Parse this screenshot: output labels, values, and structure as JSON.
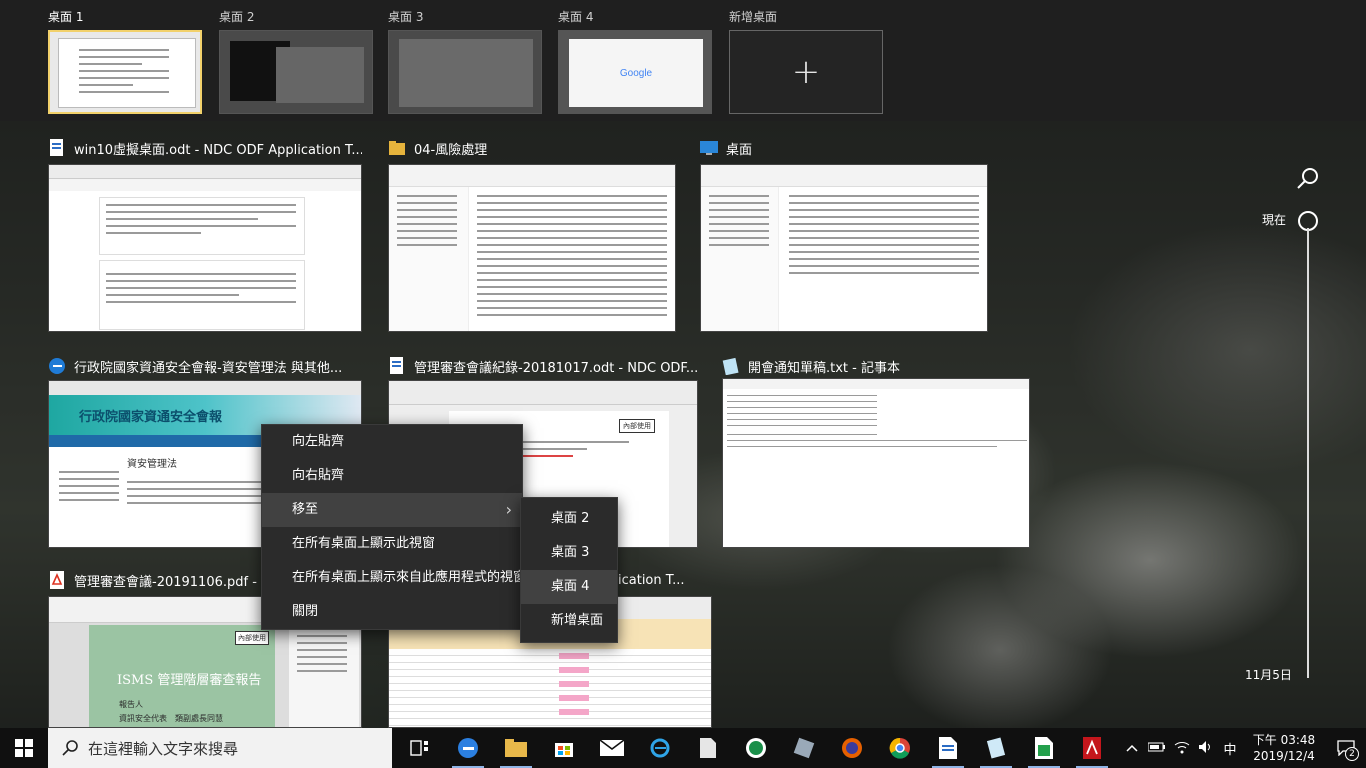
{
  "desktops": [
    {
      "label": "桌面 1",
      "active": true
    },
    {
      "label": "桌面 2",
      "active": false
    },
    {
      "label": "桌面 3",
      "active": false
    },
    {
      "label": "桌面 4",
      "active": false
    },
    {
      "label": "新增桌面",
      "active": false
    }
  ],
  "add_desktop_symbol": "+",
  "windows": [
    {
      "title": "win10虛擬桌面.odt - NDC ODF Application T...",
      "icon": "writer-doc-icon"
    },
    {
      "title": "04-風險處理",
      "icon": "folder-icon"
    },
    {
      "title": "桌面",
      "icon": "desktop-icon"
    },
    {
      "title": "行政院國家資通安全會報-資安管理法 與其他...",
      "icon": "edge-icon"
    },
    {
      "title": "管理審查會議紀錄-20181017.odt - NDC ODF...",
      "icon": "writer-doc-icon"
    },
    {
      "title": "開會通知單稿.txt - 記事本",
      "icon": "notepad-icon"
    },
    {
      "title": "管理審查會議-20191106.pdf - Ado",
      "icon": "pdf-icon"
    },
    {
      "title": "ication T...",
      "icon": "writer-doc-icon"
    }
  ],
  "thumb_text": {
    "google": "Google",
    "site_title": "行政院國家資通安全會報",
    "site_section": "資安管理法",
    "pdf_stamp": "內部使用",
    "pdf_title": "ISMS 管理階層審查報告",
    "pdf_presenter": "報告人",
    "pdf_presenter_line": "資訊安全代表　類副處長同慧",
    "doc_stamp": "內部使用",
    "notepad_title": "開會通知單稿.txt - 記事本"
  },
  "context_menu": {
    "items": [
      {
        "label": "向左貼齊"
      },
      {
        "label": "向右貼齊"
      },
      {
        "label": "移至",
        "has_submenu": true
      },
      {
        "label": "在所有桌面上顯示此視窗"
      },
      {
        "label": "在所有桌面上顯示來自此應用程式的視窗"
      },
      {
        "label": "關閉"
      }
    ],
    "submenu": [
      {
        "label": "桌面 2"
      },
      {
        "label": "桌面 3"
      },
      {
        "label": "桌面 4",
        "hover": true
      },
      {
        "label": "新增桌面"
      }
    ],
    "submenu_arrow": "›"
  },
  "timeline": {
    "now_label": "現在",
    "date_label": "11月5日"
  },
  "taskbar": {
    "search_placeholder": "在這裡輸入文字來搜尋",
    "time": "下午 03:48",
    "date": "2019/12/4",
    "ime": "中",
    "notification_count": "2",
    "pinned": [
      "task-view-icon",
      "edge-icon",
      "file-explorer-icon",
      "store-icon",
      "mail-icon",
      "ie-icon",
      "document-icon",
      "app-green-icon",
      "tools-icon",
      "firefox-icon",
      "chrome-icon",
      "writer-icon",
      "notepad-icon",
      "calc-icon",
      "pdf-icon"
    ]
  },
  "colors": {
    "active_desktop_border": "#f2d16b",
    "taskbar_bg": "#101010",
    "menu_bg": "#2b2b2b"
  }
}
